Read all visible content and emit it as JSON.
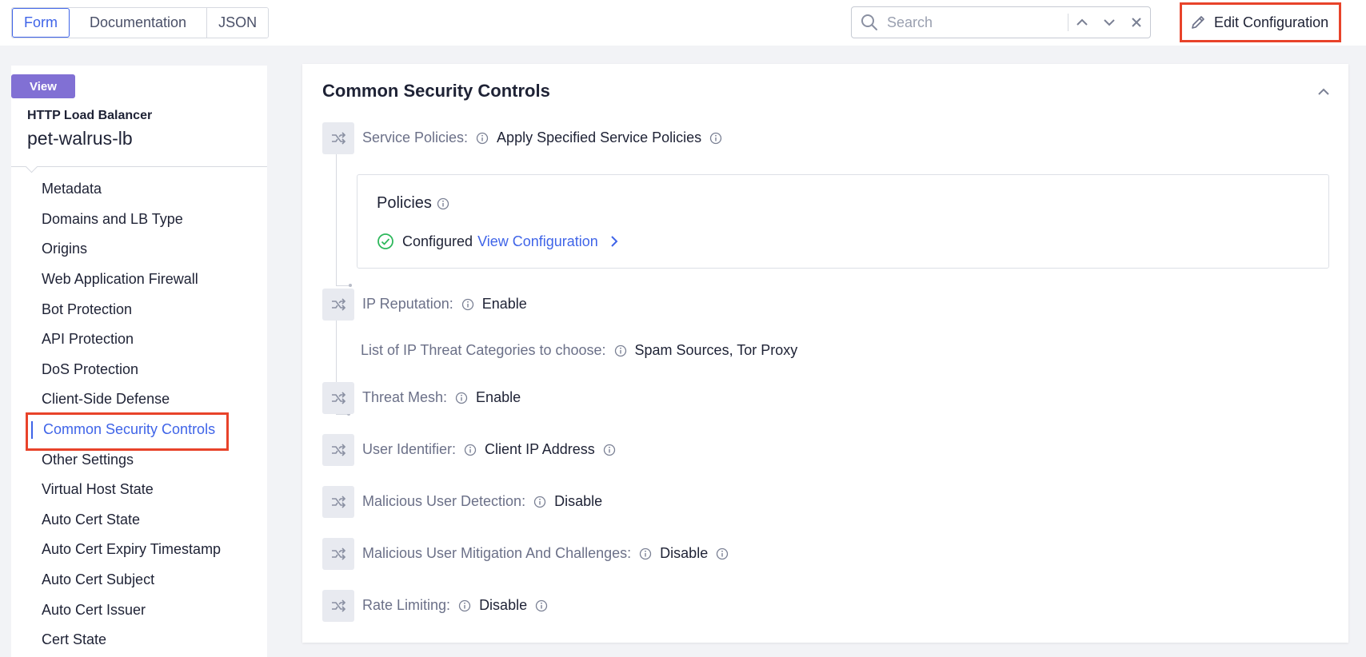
{
  "topbar": {
    "tabs": [
      "Form",
      "Documentation",
      "JSON"
    ],
    "search_placeholder": "Search",
    "edit_label": "Edit Configuration"
  },
  "sidebar": {
    "badge": "View",
    "type": "HTTP Load Balancer",
    "name": "pet-walrus-lb",
    "items": [
      "Metadata",
      "Domains and LB Type",
      "Origins",
      "Web Application Firewall",
      "Bot Protection",
      "API Protection",
      "DoS Protection",
      "Client-Side Defense",
      "Common Security Controls",
      "Other Settings",
      "Virtual Host State",
      "Auto Cert State",
      "Auto Cert Expiry Timestamp",
      "Auto Cert Subject",
      "Auto Cert Issuer",
      "Cert State"
    ],
    "active_item": "Common Security Controls"
  },
  "section": {
    "title": "Common Security Controls",
    "service_policies": {
      "label": "Service Policies:",
      "value": "Apply Specified Service Policies"
    },
    "policies": {
      "title": "Policies",
      "status": "Configured",
      "link": "View Configuration"
    },
    "ip_reputation": {
      "label": "IP Reputation:",
      "value": "Enable"
    },
    "ip_threat_categories": {
      "label": "List of IP Threat Categories to choose:",
      "value": "Spam Sources, Tor Proxy"
    },
    "threat_mesh": {
      "label": "Threat Mesh:",
      "value": "Enable"
    },
    "user_identifier": {
      "label": "User Identifier:",
      "value": "Client IP Address"
    },
    "malicious_user_detection": {
      "label": "Malicious User Detection:",
      "value": "Disable"
    },
    "malicious_user_mitigation": {
      "label": "Malicious User Mitigation And Challenges:",
      "value": "Disable"
    },
    "rate_limiting": {
      "label": "Rate Limiting:",
      "value": "Disable"
    }
  },
  "colors": {
    "accent": "#3f64e8",
    "highlight": "#e8432a",
    "badge": "#8170d4",
    "success": "#2eb85c"
  }
}
